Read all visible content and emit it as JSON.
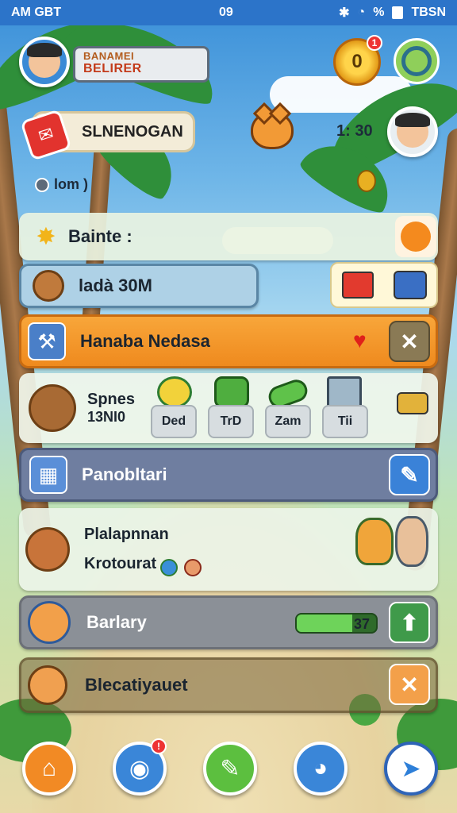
{
  "status_bar": {
    "left": "AM",
    "carrier": "GBT",
    "time": "09",
    "battery": "%",
    "right": "TBSN"
  },
  "header": {
    "name_plate_line1": "BANAMEI",
    "name_plate_line2": "BELIRER",
    "coin_glyph": "0",
    "coin_badge": "1",
    "banner_label": "SLNENOGAN",
    "timer": "1: 30",
    "meta_label": "lom )"
  },
  "rows": {
    "balance_label": "Bainte :",
    "level_label": "ladà 30M",
    "event_label": "Hanaba Nedasa",
    "items_title": "Spnes",
    "items_sub": "13NI0",
    "items": [
      {
        "label": "Ded"
      },
      {
        "label": "TrD"
      },
      {
        "label": "Zam"
      },
      {
        "label": "Tii"
      }
    ],
    "panel_label": "Panobltari",
    "recruit_title": "Plalapnnan",
    "recruit_sub": "Krotourat",
    "salary_label": "Barlary",
    "salary_value": "37",
    "salary_progress": 0.7,
    "collect_label": "Blecatiyauet"
  },
  "colors": {
    "accent_orange": "#ef8a1e",
    "status_blue": "#2c74c9",
    "progress_green": "#6ed35a"
  },
  "nav": [
    {
      "icon": "home-icon"
    },
    {
      "icon": "globe-icon",
      "badge": "!"
    },
    {
      "icon": "chat-bubble-icon"
    },
    {
      "icon": "fox-icon"
    },
    {
      "icon": "send-icon"
    }
  ]
}
